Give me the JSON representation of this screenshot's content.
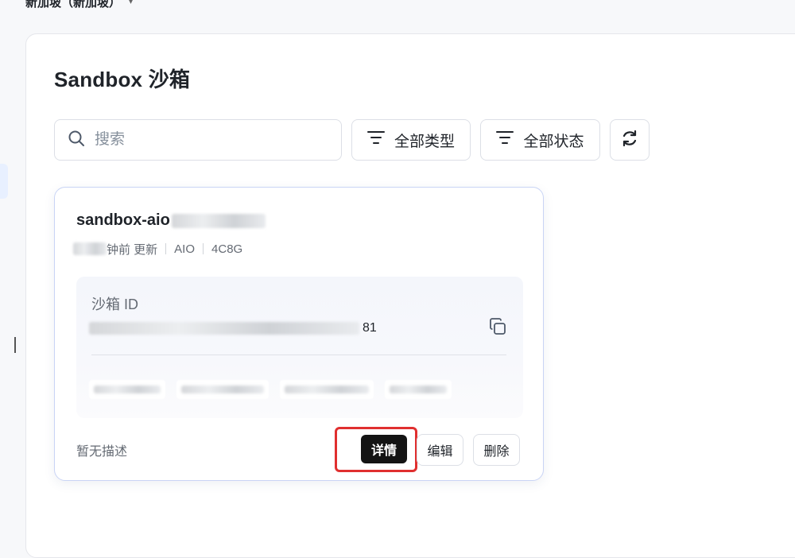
{
  "breadcrumb": {
    "label": "新加坡（新加坡）"
  },
  "page": {
    "title": "Sandbox 沙箱"
  },
  "toolbar": {
    "search_placeholder": "搜索",
    "filter_type_label": "全部类型",
    "filter_status_label": "全部状态"
  },
  "card": {
    "name_prefix": "sandbox-aio",
    "updated_suffix": "钟前 更新",
    "type": "AIO",
    "spec": "4C8G",
    "id_label": "沙箱 ID",
    "id_tail": "81",
    "description": "暂无描述",
    "actions": {
      "detail": "详情",
      "edit": "编辑",
      "delete": "删除"
    }
  },
  "colors": {
    "highlight": "#e02f2f",
    "primary_button": "#141414",
    "card_border": "#c9d4f5"
  },
  "icons": {
    "search": "search-icon",
    "filter": "filter-icon",
    "refresh": "refresh-icon",
    "copy": "copy-icon",
    "dropdown": "chevron-down-icon"
  }
}
